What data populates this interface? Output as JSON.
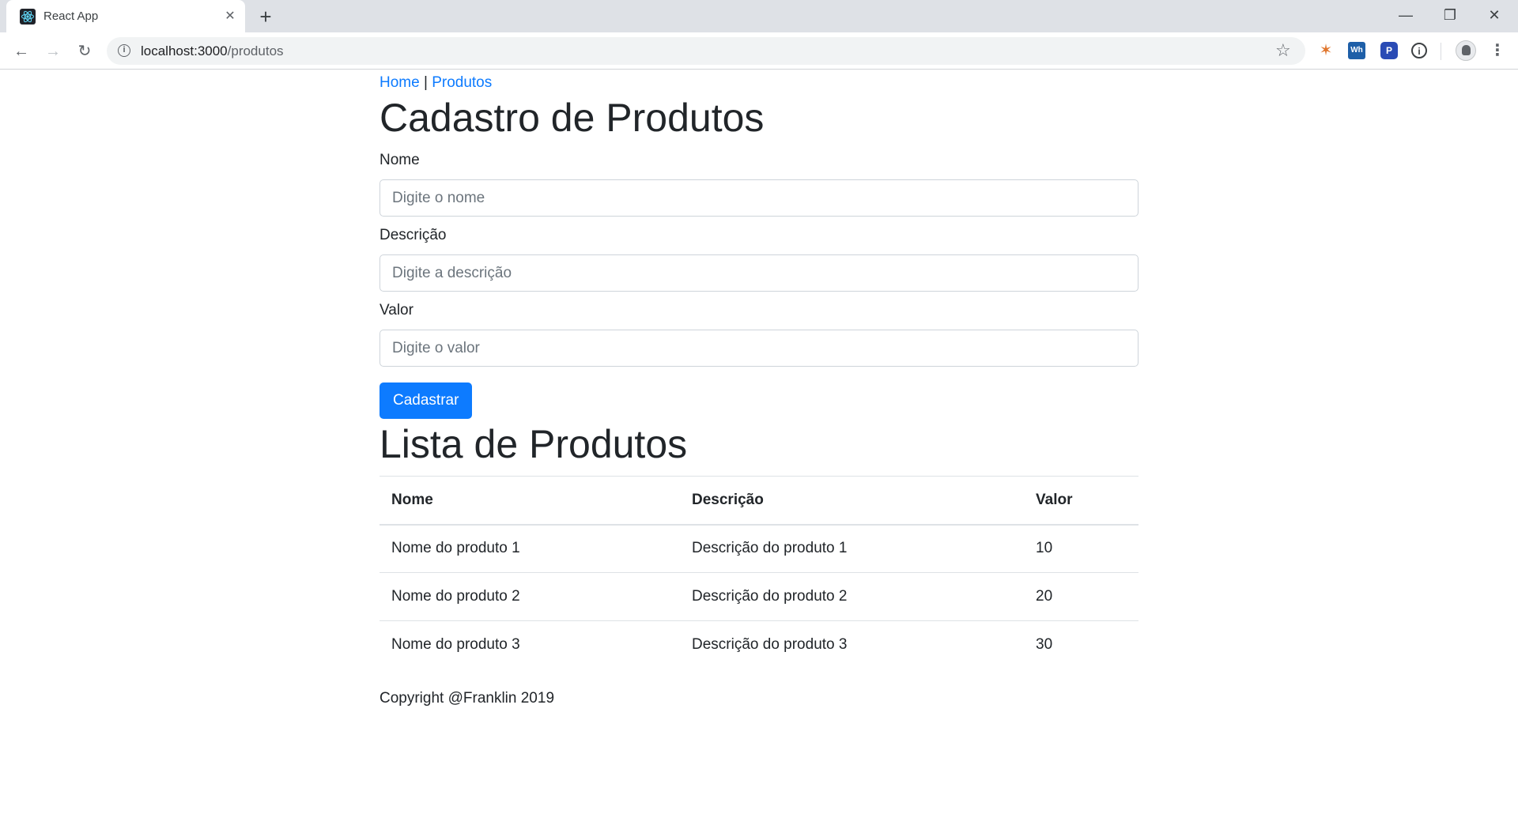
{
  "browser": {
    "tab_title": "React App",
    "tab_close": "✕",
    "new_tab": "+",
    "url_host": "localhost:3000",
    "url_path": "/produtos",
    "window_controls": {
      "minimize": "—",
      "maximize": "❐",
      "close": "✕"
    },
    "extensions": [
      "nimbus-icon",
      "wh-extension-icon",
      "p-extension-icon",
      "info-extension-icon"
    ],
    "ext_labels": {
      "wh": "Wh",
      "p": "P",
      "info": "i"
    }
  },
  "nav": {
    "home": "Home",
    "separator": "|",
    "produtos": "Produtos"
  },
  "form": {
    "title": "Cadastro de Produtos",
    "nome_label": "Nome",
    "nome_placeholder": "Digite o nome",
    "descricao_label": "Descrição",
    "descricao_placeholder": "Digite a descrição",
    "valor_label": "Valor",
    "valor_placeholder": "Digite o valor",
    "submit_label": "Cadastrar"
  },
  "list": {
    "title": "Lista de Produtos",
    "headers": [
      "Nome",
      "Descrição",
      "Valor"
    ],
    "rows": [
      [
        "Nome do produto 1",
        "Descrição do produto 1",
        "10"
      ],
      [
        "Nome do produto 2",
        "Descrição do produto 2",
        "20"
      ],
      [
        "Nome do produto 3",
        "Descrição do produto 3",
        "30"
      ]
    ]
  },
  "footer": {
    "text": "Copyright @Franklin 2019"
  },
  "colors": {
    "primary": "#0d7bff",
    "text": "#212529",
    "border": "#dee2e6"
  }
}
